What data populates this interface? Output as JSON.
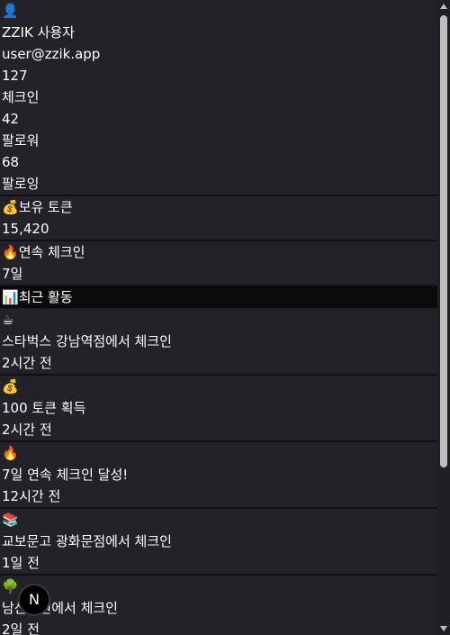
{
  "profile": {
    "avatar_icon": "👤",
    "name": "ZZIK 사용자",
    "email": "user@zzik.app",
    "checkins_value": "127",
    "checkins_label": "체크인",
    "followers_value": "42",
    "followers_label": "팔로워",
    "following_value": "68",
    "following_label": "팔로잉"
  },
  "tokens": {
    "icon": "💰",
    "label": "보유 토큰",
    "value": "15,420"
  },
  "streak": {
    "icon": "🔥",
    "label": "연속 체크인",
    "value": "7일"
  },
  "recent": {
    "icon": "📊",
    "title": "최근 활동"
  },
  "activities": [
    {
      "icon": "☕",
      "text": "스타벅스 강남역점에서 체크인",
      "time": "2시간 전"
    },
    {
      "icon": "💰",
      "text": "100 토큰 획득",
      "time": "2시간 전"
    },
    {
      "icon": "🔥",
      "text": "7일 연속 체크인 달성!",
      "time": "12시간 전"
    },
    {
      "icon": "📚",
      "text": "교보문고 광화문점에서 체크인",
      "time": "1일 전"
    },
    {
      "icon": "🌳",
      "text": "남산공원에서 체크인",
      "time": "2일 전"
    }
  ],
  "badge": {
    "label": "N"
  }
}
